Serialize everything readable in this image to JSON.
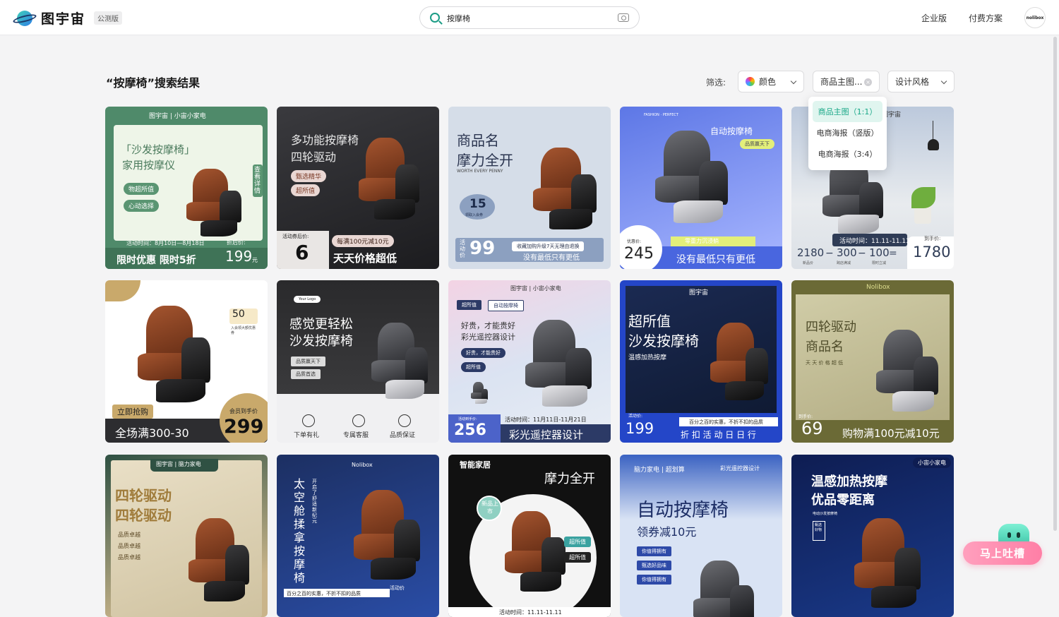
{
  "header": {
    "brand": "图宇宙",
    "badge": "公测版",
    "search_value": "按摩椅",
    "links": [
      "企业版",
      "付费方案"
    ],
    "avatar_text": "nolibox"
  },
  "results": {
    "title": "“按摩椅”搜索结果",
    "filter_label": "筛选:",
    "filters": {
      "color": "颜色",
      "type": "商品主图...",
      "style": "设计风格"
    },
    "dropdown_options": [
      "商品主图（1:1）",
      "电商海报（竖版）",
      "电商海报（3:4）"
    ]
  },
  "cards": {
    "c1": {
      "brand": "图宇宙 | 小宙小家电",
      "title1": "「沙发按摩椅」",
      "title2": "家用按摩仪",
      "tag1": "物超所值",
      "tag2": "心动选择",
      "side": "查看详情",
      "date": "活动时间：8月10日—8月18日",
      "promo": "限时优惠 限时5折",
      "after_label": "折后价:",
      "price": "199",
      "unit": "元"
    },
    "c2": {
      "title1": "多功能按摩椅",
      "title2": "四轮驱动",
      "tag1": "甄选精华",
      "tag2": "超所值",
      "after_label": "活动券后价:",
      "price": "6",
      "promo_top": "每满100元减10元",
      "promo": "天天价格超低"
    },
    "c3": {
      "title1": "商品名",
      "title2": "摩力全开",
      "sub": "WORTH EVERY PENNY",
      "coupon": "15",
      "coupon_sub": "领取入会券",
      "label": "活动价",
      "price": "99",
      "note1": "收藏加购升级7天无理由退换",
      "note2": "没有最低只有更低"
    },
    "c4": {
      "top": "FASHION · PERFECT",
      "title": "自动按摩椅",
      "tag": "品质赢天下",
      "label": "优惠价:",
      "price": "245",
      "strip": "零重力沉浸躺",
      "promo": "没有最低只有更低"
    },
    "c5": {
      "brand": "图宇宙",
      "date": "活动时间：11.11-11.11",
      "p1": "2180",
      "p2": "300",
      "p3": "100",
      "l1": "新品价",
      "l2": "跨店满减",
      "l3": "限时立减",
      "label": "到手价:",
      "price": "1780"
    },
    "c6": {
      "coupon": "50",
      "coupon_sub": "入会领大额优惠券",
      "tag": "立即抢购",
      "promo": "全场满300-30",
      "label": "会员到手价",
      "price": "299"
    },
    "c7": {
      "logo": "Your Logo",
      "title1": "感觉更轻松",
      "title2": "沙发按摩椅",
      "tag1": "品质赢天下",
      "tag2": "品质首选",
      "i1": "下单有礼",
      "i2": "专属客服",
      "i3": "品质保证"
    },
    "c8": {
      "brand": "图宇宙 | 小宙小家电",
      "tag1": "超所值",
      "tag2": "自动按摩椅",
      "line1": "好贵，才能贵好",
      "line2": "彩光遥控器设计",
      "tag3": "好贵，才能贵好",
      "tag4": "超所值",
      "date": "活动时间：11月11日-11月21日",
      "label": "活动到手价:",
      "price": "256",
      "promo": "彩光遥控器设计"
    },
    "c9": {
      "brand": "图宇宙",
      "title1": "超所值",
      "title2": "沙发按摩椅",
      "sub": "温感加热按摩",
      "label": "活动价:",
      "price": "199",
      "note": "百分之百的实惠，不折不扣的品质",
      "promo": "折 扣 活 动 日 日 行"
    },
    "c10": {
      "brand": "Nolibox",
      "title1": "四轮驱动",
      "title2": "商品名",
      "sub": "天 天 价 格 超 低",
      "label": "到手价:",
      "price": "69",
      "promo": "购物满100元减10元"
    },
    "c11": {
      "brand": "图宇宙 | 脑力家电",
      "title1": "四轮驱动",
      "title2": "四轮驱动",
      "b1": "品质卓越",
      "b2": "品质卓越",
      "b3": "品质卓越"
    },
    "c12": {
      "brand": "Nolibox",
      "title": "太空舱揉拿按摩椅",
      "sub": "开启了舒适新纪元",
      "note": "百分之百的实惠，不折不扣的品质",
      "label": "活动价"
    },
    "c13": {
      "tag": "智能家居",
      "title": "摩力全开",
      "badge": "新品上市",
      "t1": "超所值",
      "t2": "超所值",
      "label": "到手价",
      "date": "活动时间：11.11-11.11"
    },
    "c14": {
      "brand": "脑力家电 | 超划算",
      "side": "彩光遥控器设计",
      "title": "自动按摩椅",
      "sub": "领券减10元",
      "t1": "你值得拥有",
      "t2": "甄选好品味",
      "t3": "你值得拥有"
    },
    "c15": {
      "brand": "小宙小家电",
      "title1": "温感加热按摩",
      "title2": "优品零距离",
      "sub": "电动沙发按摩椅",
      "badge": "甄选好物"
    }
  },
  "feedback": {
    "label": "马上吐槽"
  }
}
